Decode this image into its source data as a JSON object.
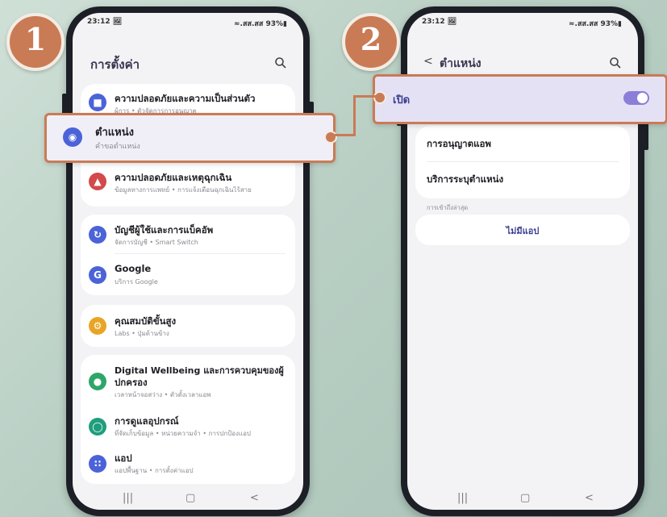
{
  "left_phone": {
    "step": "1",
    "status": {
      "time": "23:12 🖼",
      "right": "≈.สส.สส 93%▮"
    },
    "title": "การตั้งค่า",
    "items": [
      {
        "label": "ความปลอดภัยและความเป็นส่วนตัว",
        "sub": "ผู้การ • ตัวจัดการการอนุญาต"
      },
      {
        "label": "ตำแหน่ง",
        "sub": "คำขอตำแหน่ง"
      },
      {
        "label": "ความปลอดภัยและเหตุฉุกเฉิน",
        "sub": "ข้อมูลทางการแพทย์ • การแจ้งเตือนฉุกเฉินไร้สาย"
      },
      {
        "label": "บัญชีผู้ใช้และการแบ็คอัพ",
        "sub": "จัดการบัญชี • Smart Switch"
      },
      {
        "label": "Google",
        "sub": "บริการ Google"
      },
      {
        "label": "คุณสมบัติขั้นสูง",
        "sub": "Labs • ปุ่มด้านข้าง"
      },
      {
        "label": "Digital Wellbeing และการควบคุมของผู้",
        "label2": "ปกครอง",
        "sub": "เวลาหน้าจอสว่าง • ตัวตั้งเวลาแอพ"
      },
      {
        "label": "การดูแลอุปกรณ์",
        "sub": "ที่จัดเก็บข้อมูล • หน่วยความจำ • การปกป้องแอป"
      },
      {
        "label": "แอป",
        "sub": "แอปพื้นฐาน • การตั้งค่าแอป"
      }
    ],
    "nav": {
      "recent": "|||",
      "home": "▢",
      "back": "<"
    }
  },
  "right_phone": {
    "step": "2",
    "status": {
      "time": "23:12 🖼",
      "right": "≈.สส.สส 93%▮"
    },
    "title": "ตำแหน่ง",
    "back": "<",
    "toggle_label": "เปิด",
    "toggle_on": true,
    "items": [
      {
        "label": "การอนุญาตแอพ"
      },
      {
        "label": "บริการระบุตำแหน่ง"
      }
    ],
    "recent_header": "การเข้าถึงล่าสุด",
    "no_app": "ไม่มีแอป",
    "nav": {
      "recent": "|||",
      "home": "▢",
      "back": "<"
    }
  },
  "colors": {
    "accent": "#c97b55",
    "toggle": "#8b7ed8",
    "icon_blue": "#4b63d8",
    "icon_red": "#d24a4a",
    "icon_yellow": "#e8a525",
    "icon_green": "#2ea66a",
    "icon_teal": "#1f9e7d"
  }
}
